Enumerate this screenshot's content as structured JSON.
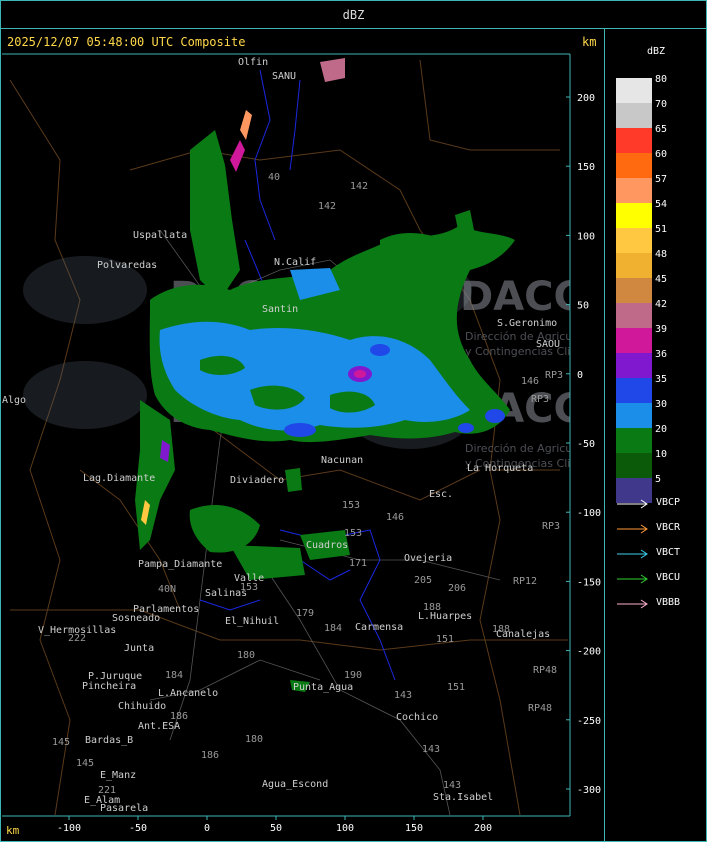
{
  "header": {
    "title": "dBZ"
  },
  "map": {
    "timestamp": "2025/12/07 05:48:00 UTC Composite",
    "km_label_top": "km",
    "km_label_bottom": "km",
    "x_ticks": [
      "-100",
      "-50",
      "0",
      "50",
      "100",
      "150",
      "200"
    ],
    "y_ticks": [
      "200",
      "150",
      "100",
      "50",
      "0",
      "-50",
      "-100",
      "-150",
      "-200",
      "-250",
      "-300"
    ],
    "places": [
      "Olfin",
      "SANU",
      "Uspallata",
      "Polvaredas",
      "N.Calif",
      "Santin",
      "S.Geronimo",
      "SAOU",
      "Nacunan",
      "La Horqueta",
      "Lag.Diamante",
      "Diviadero",
      "Esc.",
      "Pampa_Diamante",
      "Parlamentos",
      "Sosneado",
      "V_Hermosillas",
      "Junta",
      "P.Juruque",
      "Pincheira",
      "Chihuido",
      "L.Ancanelo",
      "Ant.ESA",
      "Bardas_B",
      "E_Manz",
      "E_Alam",
      "Pasarela",
      "Punta_Agua",
      "Agua_Escond",
      "Cochico",
      "Sta.Isabel",
      "Carmensa",
      "Ovejeria",
      "L.Huarpes",
      "Canalejas",
      "El_Nihuil",
      "Salinas",
      "Cuadros",
      "Valle",
      "Algo"
    ],
    "roads": [
      "40",
      "142",
      "142",
      "146",
      "146",
      "153",
      "153",
      "153",
      "171",
      "179",
      "184",
      "184",
      "180",
      "180",
      "186",
      "186",
      "190",
      "143",
      "143",
      "143",
      "151",
      "151",
      "205",
      "206",
      "188",
      "188",
      "221",
      "222",
      "145",
      "145",
      "40N",
      "RP3",
      "RP3",
      "RP3",
      "RP12",
      "RP48",
      "RP48"
    ],
    "watermark": [
      "DACC",
      "Dirección de Agricultura",
      "y Contingencias Climáticas"
    ]
  },
  "legend": {
    "title": "dBZ",
    "scale": [
      {
        "label": "80",
        "color": "#e6e6e6"
      },
      {
        "label": "70",
        "color": "#c8c8c8"
      },
      {
        "label": "65",
        "color": "#ff3a28"
      },
      {
        "label": "60",
        "color": "#ff6a10"
      },
      {
        "label": "57",
        "color": "#ff9860"
      },
      {
        "label": "54",
        "color": "#ffff00"
      },
      {
        "label": "51",
        "color": "#ffc840"
      },
      {
        "label": "48",
        "color": "#f0b030"
      },
      {
        "label": "45",
        "color": "#d08840"
      },
      {
        "label": "42",
        "color": "#c06a8a"
      },
      {
        "label": "39",
        "color": "#d0189a"
      },
      {
        "label": "36",
        "color": "#8018d0"
      },
      {
        "label": "35",
        "color": "#2048e8"
      },
      {
        "label": "30",
        "color": "#1a8ee8"
      },
      {
        "label": "20",
        "color": "#0a7a14"
      },
      {
        "label": "10",
        "color": "#0a5a0a"
      },
      {
        "label": "5",
        "color": "#40388a"
      }
    ],
    "radars": [
      {
        "label": "VBCP",
        "color": "#ffffff"
      },
      {
        "label": "VBCR",
        "color": "#ff9a3a"
      },
      {
        "label": "VBCT",
        "color": "#40d0f0"
      },
      {
        "label": "VBCU",
        "color": "#30d030"
      },
      {
        "label": "VBBB",
        "color": "#ffb0d0"
      }
    ]
  }
}
